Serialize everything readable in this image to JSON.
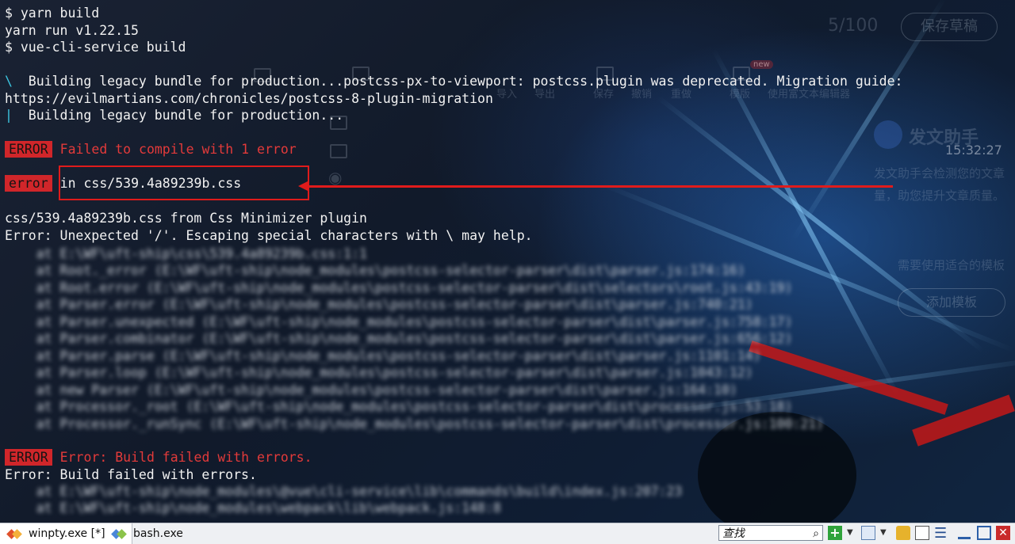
{
  "terminal": {
    "lines": {
      "l1": "$ yarn build",
      "l2": "yarn run v1.22.15",
      "l3": "$ vue-cli-service build",
      "l4_spinner": "\\",
      "l4": "  Building legacy bundle for production...postcss-px-to-viewport: postcss.plugin was deprecated. Migration guide:",
      "l5": "https://evilmartians.com/chronicles/postcss-8-plugin-migration",
      "l6_spinner": "|",
      "l6": "  Building legacy bundle for production...",
      "err1_tag": "ERROR",
      "err1_msg": "Failed to compile with 1 error",
      "err2_tag": "error",
      "err2_msg": "in css/539.4a89239b.css",
      "l9": "css/539.4a89239b.css from Css Minimizer plugin",
      "l10": "Error: Unexpected '/'. Escaping special characters with \\ may help.",
      "err3_tag": "ERROR",
      "err3_msg": "Error: Build failed with errors.",
      "l22": "Error: Build failed with errors."
    }
  },
  "background_app": {
    "word_count": "5/100",
    "save_draft": "保存草稿",
    "toolbar": [
      "导入",
      "导出",
      "保存",
      "撤销",
      "重做",
      "模版",
      "使用富文本编辑器"
    ],
    "new_badge": "new",
    "assistant_title": "发文助手",
    "assistant_time": "15:32:27",
    "assistant_text1": "发文助手会检测您的文章",
    "assistant_text2": "量，助您提升文章质量。",
    "template_hint": "需要使用适合的模板",
    "add_template": "添加模板"
  },
  "taskbar": {
    "tab1": "winpty.exe [*]",
    "tab2": "bash.exe",
    "search_placeholder": "查找"
  },
  "colors": {
    "error_red": "#d0262a",
    "annotation_red": "#e01b1b",
    "terminal_text": "#f2f2f2"
  }
}
